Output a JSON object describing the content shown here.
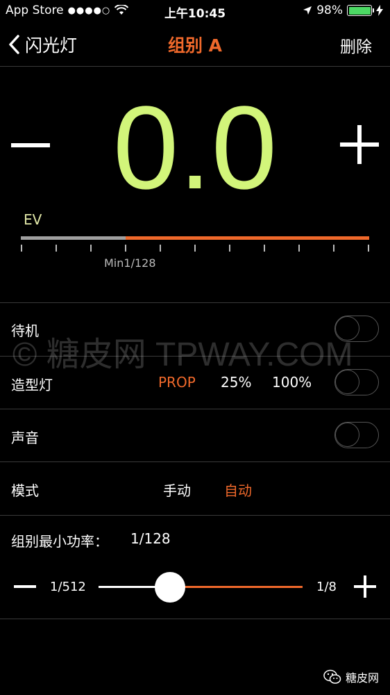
{
  "status_bar": {
    "carrier": "App Store",
    "signal": "●●●●○",
    "time": "上午10:45",
    "battery": "98%"
  },
  "nav": {
    "back_label": "闪光灯",
    "title": "组别 A",
    "delete_label": "删除"
  },
  "exposure": {
    "value": "0.0",
    "unit_label": "EV",
    "min_label": "Min1/128",
    "level": 0.3
  },
  "rows": {
    "standby": {
      "label": "待机",
      "on": false
    },
    "modeling": {
      "label": "造型灯",
      "options": [
        "PROP",
        "25%",
        "100%"
      ],
      "selected": "PROP",
      "on": false
    },
    "sound": {
      "label": "声音",
      "on": false
    },
    "mode": {
      "label": "模式",
      "options": [
        "手动",
        "自动"
      ],
      "selected": "自动"
    }
  },
  "min_power": {
    "label": "组别最小功率：",
    "value": "1/128",
    "slider_min": "1/512",
    "slider_max": "1/8",
    "slider_fraction": 0.35
  },
  "watermark": "© 糖皮网 TPWAY.COM",
  "corner_brand": "糖皮网",
  "colors": {
    "accent": "#f0692b",
    "value": "#d2f57a",
    "background": "#000000"
  }
}
